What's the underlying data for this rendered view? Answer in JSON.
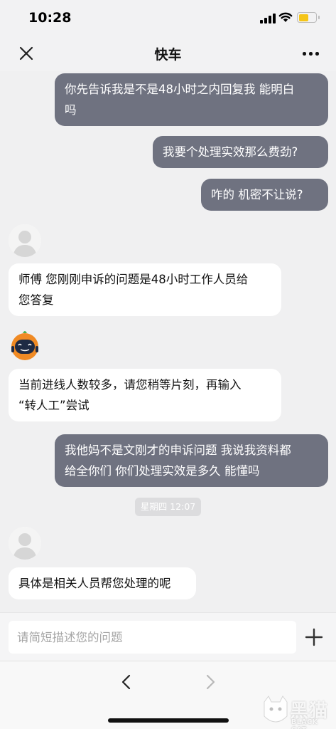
{
  "status_bar": {
    "time": "10:28"
  },
  "header": {
    "title": "快车"
  },
  "messages": [
    {
      "from": "me",
      "lines": [
        "你先告诉我是不是48小时之内回复我 能明白",
        "吗"
      ]
    },
    {
      "from": "me",
      "lines": [
        "我要个处理实效那么费劲?"
      ]
    },
    {
      "from": "me",
      "lines": [
        "咋的 机密不让说?"
      ]
    },
    {
      "from": "agent",
      "lines": [
        "师傅 您刚刚申诉的问题是48小时工作人员给",
        "您答复"
      ]
    },
    {
      "from": "bot",
      "lines": [
        "当前进线人数较多，请您稍等片刻，再输入",
        "“转人工”尝试"
      ]
    },
    {
      "from": "me",
      "lines": [
        "我他妈不是文刚才的申诉问题 我说我资料都",
        "给全你们 你们处理实效是多久 能懂吗"
      ]
    },
    {
      "from": "agent",
      "lines": [
        "具体是相关人员帮您处理的呢"
      ]
    }
  ],
  "timestamp": "星期四 12:07",
  "input": {
    "placeholder": "请简短描述您的问题"
  },
  "watermark": {
    "cn": "黑猫",
    "en": "BLACK CAT"
  },
  "icons": {
    "close": "close-icon",
    "more": "more-icon",
    "plus": "plus-icon",
    "back": "chevron-left-icon",
    "forward": "chevron-right-icon"
  },
  "colors": {
    "my_bubble": "#6f7280",
    "their_bubble": "#ffffff",
    "background": "#f0f0f1",
    "battery": "#f5c518"
  }
}
